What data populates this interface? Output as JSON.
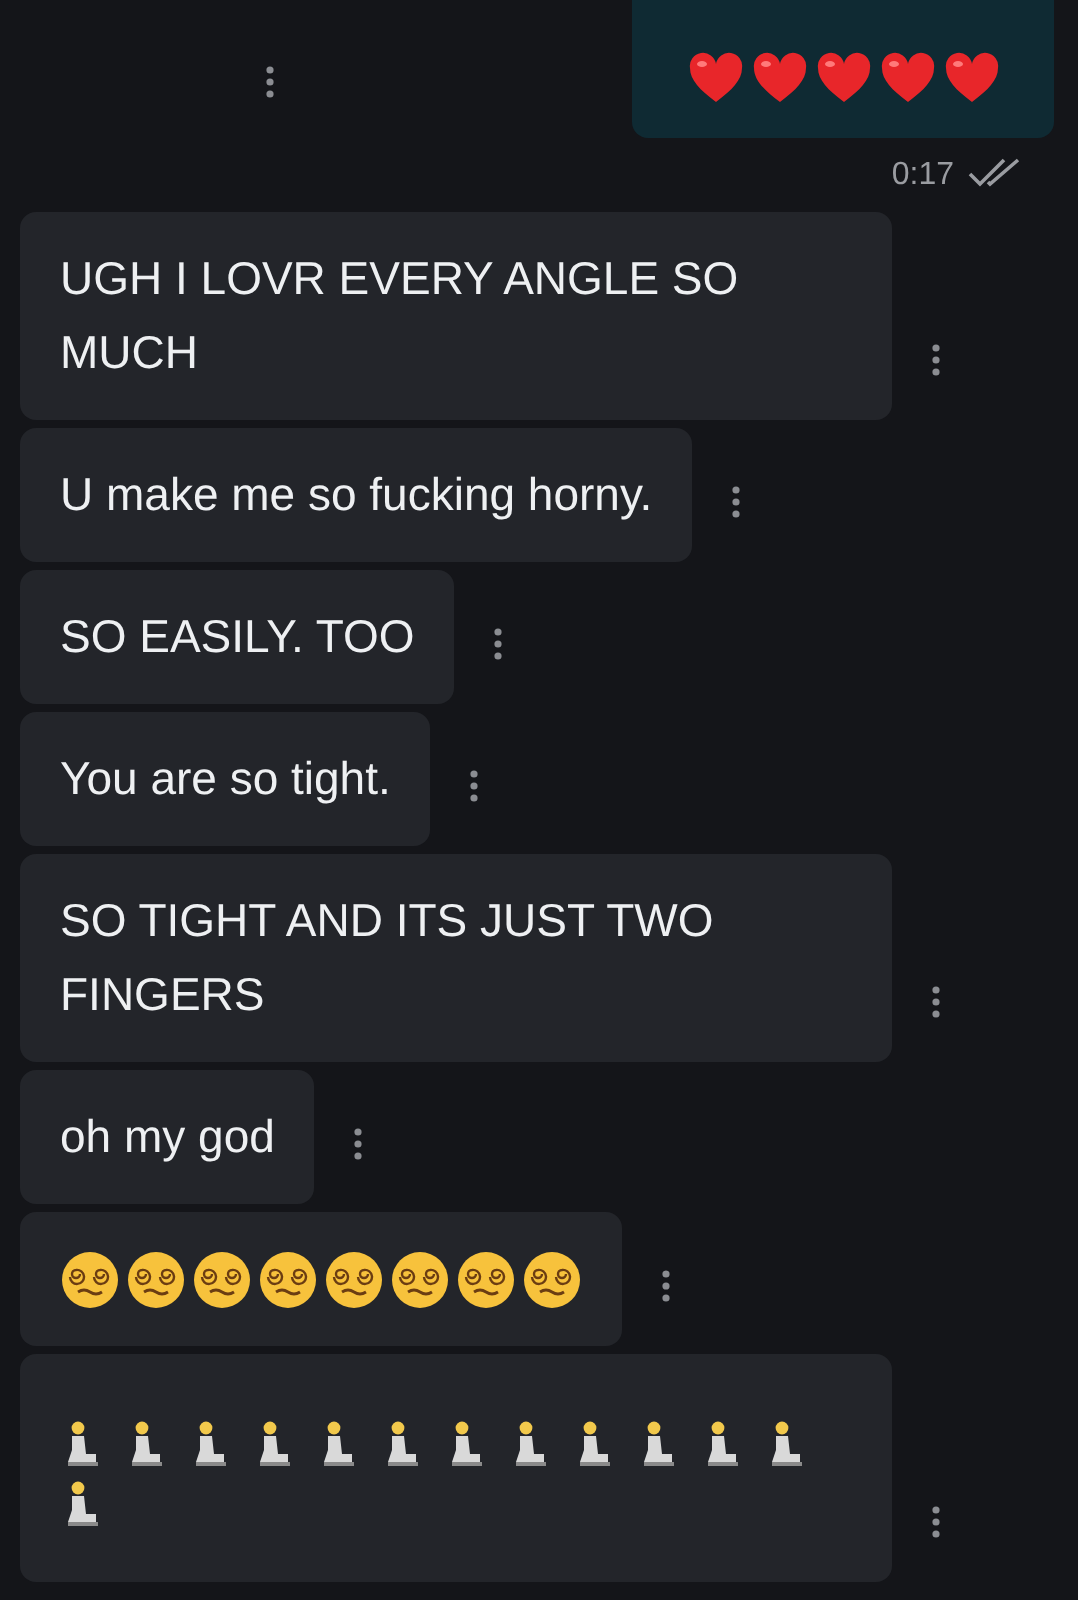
{
  "outgoing": {
    "emojis": [
      {
        "kind": "heart"
      },
      {
        "kind": "heart"
      },
      {
        "kind": "heart"
      },
      {
        "kind": "heart"
      },
      {
        "kind": "heart"
      }
    ],
    "time": "0:17",
    "read": true
  },
  "messages": [
    {
      "kind": "text",
      "text": "UGH I LOVR EVERY ANGLE SO MUCH"
    },
    {
      "kind": "text",
      "text": "U make me so fucking horny."
    },
    {
      "kind": "text",
      "text": "SO EASILY. TOO"
    },
    {
      "kind": "text",
      "text": "You are so tight."
    },
    {
      "kind": "text",
      "text": "SO TIGHT AND ITS JUST TWO FINGERS"
    },
    {
      "kind": "text",
      "text": "oh my god"
    },
    {
      "kind": "emoji",
      "emojis": [
        {
          "kind": "spiral-face"
        },
        {
          "kind": "spiral-face"
        },
        {
          "kind": "spiral-face"
        },
        {
          "kind": "spiral-face"
        },
        {
          "kind": "spiral-face"
        },
        {
          "kind": "spiral-face"
        },
        {
          "kind": "spiral-face"
        },
        {
          "kind": "spiral-face"
        }
      ]
    },
    {
      "kind": "emoji",
      "emojis": [
        {
          "kind": "kneeling-person"
        },
        {
          "kind": "kneeling-person"
        },
        {
          "kind": "kneeling-person"
        },
        {
          "kind": "kneeling-person"
        },
        {
          "kind": "kneeling-person"
        },
        {
          "kind": "kneeling-person"
        },
        {
          "kind": "kneeling-person"
        },
        {
          "kind": "kneeling-person"
        },
        {
          "kind": "kneeling-person"
        },
        {
          "kind": "kneeling-person"
        },
        {
          "kind": "kneeling-person"
        },
        {
          "kind": "kneeling-person"
        },
        {
          "kind": "kneeling-person"
        }
      ]
    }
  ]
}
